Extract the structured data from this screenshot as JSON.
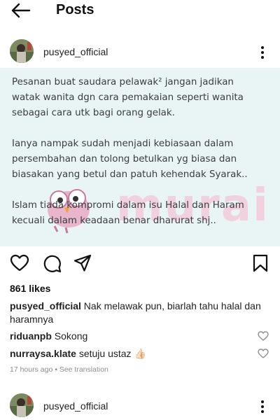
{
  "header": {
    "title": "Posts",
    "back_icon": "arrow-left-icon"
  },
  "post": {
    "username": "pusyed_official",
    "caption_lines": "Pesanan buat saudara pelawak² jangan jadikan\nwatak wanita dgn cara pemakaian seperti wanita\nsebagai cara utk bagi orang gelak.\n\nIanya nampak sudah menjadi kebiasaan dalam\npersembahan dan tolong betulkan yg biasa dan\nbiasakan yang betul dan patuh kehendak Syarak..\n\nIslam tiada kompromi dalam isu Halal dan Haram\nkecuali dalam keadaan benar dharurat shj..",
    "watermark": "murai",
    "likes": "861 likes",
    "caption_comment": {
      "user": "pusyed_official",
      "text": " Nak melawak pun, biarlah tahu halal dan haramnya"
    },
    "comments": [
      {
        "user": "riduanpb",
        "text": " Sokong"
      },
      {
        "user": "nurraysa.klate",
        "text": " setuju ustaz 👍🏻"
      }
    ],
    "time": "17 hours ago",
    "separator": " • ",
    "see_translation": "See translation"
  },
  "next_post": {
    "username": "pusyed_official"
  },
  "colors": {
    "post_bg": "#e9f4f5",
    "watermark": "#f3c6d6",
    "meta_gray": "#8e8e8e"
  }
}
